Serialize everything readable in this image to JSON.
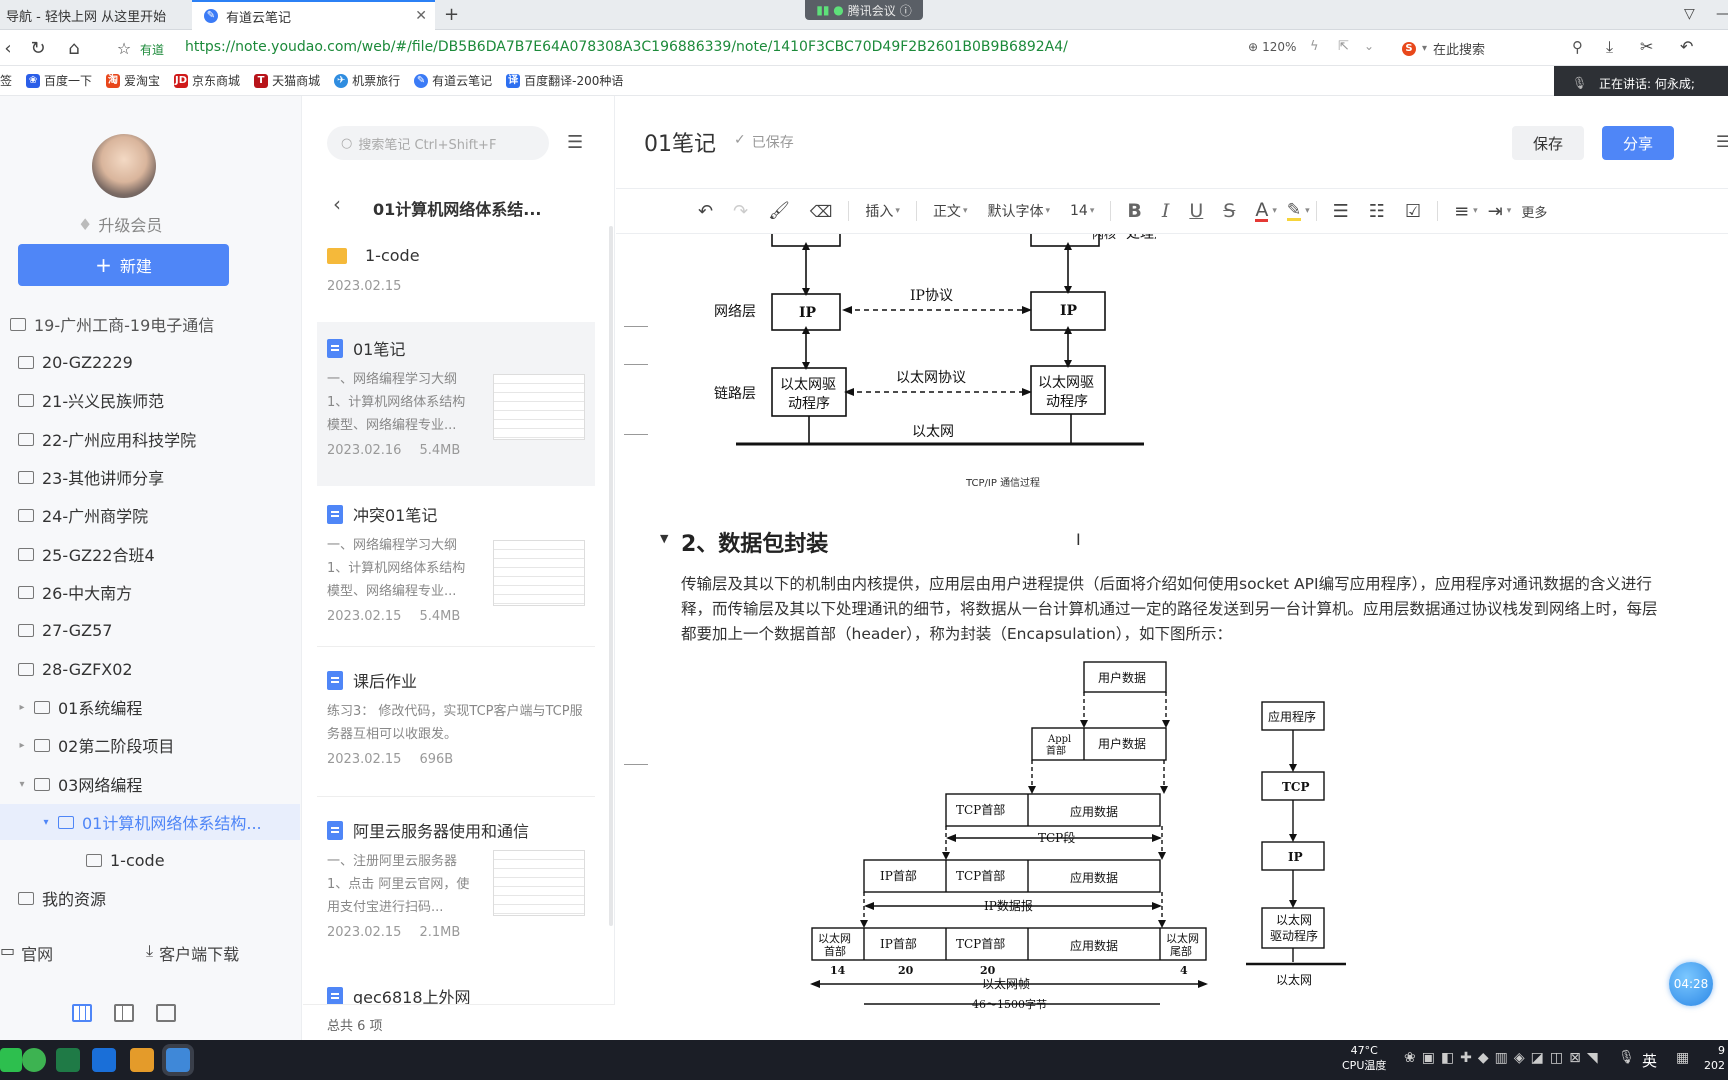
{
  "browser": {
    "tabs": [
      {
        "label": "导航 - 轻快上网 从这里开始"
      },
      {
        "label": "有道云笔记",
        "active": true
      }
    ],
    "meeting_badge": "腾讯会议",
    "url": "https://note.youdao.com/web/#/file/DB5B6DA7B7E64A078308A3C196886339/note/1410F3CBC70D49F2B2601B0B9B6892A4/",
    "site_label": "有道",
    "zoom": "120%",
    "search_placeholder": "在此搜索",
    "bookmarks": [
      "签",
      "百度一下",
      "爱淘宝",
      "京东商城",
      "天猫商城",
      "机票旅行",
      "有道云笔记",
      "百度翻译-200种语"
    ],
    "speaking": "正在讲话: 何永成;"
  },
  "sidebar": {
    "upgrade": "升级会员",
    "new_button": "新建",
    "tree": [
      {
        "label": "19-广州工商-19电子通信",
        "level": 0
      },
      {
        "label": "20-GZ2229",
        "level": 0
      },
      {
        "label": "21-兴义民族师范",
        "level": 0
      },
      {
        "label": "22-广州应用科技学院",
        "level": 0
      },
      {
        "label": "23-其他讲师分享",
        "level": 0
      },
      {
        "label": "24-广州商学院",
        "level": 0
      },
      {
        "label": "25-GZ22合班4",
        "level": 0
      },
      {
        "label": "26-中大南方",
        "level": 0
      },
      {
        "label": "27-GZ57",
        "level": 0
      },
      {
        "label": "28-GZFX02",
        "level": 0
      },
      {
        "label": "01系统编程",
        "level": 1
      },
      {
        "label": "02第二阶段项目",
        "level": 1
      },
      {
        "label": "03网络编程",
        "level": 1
      },
      {
        "label": "01计算机网络体系结构...",
        "level": 2
      },
      {
        "label": "1-code",
        "level": 3
      },
      {
        "label": "我的资源",
        "level": 0
      }
    ],
    "footer_official": "官网",
    "footer_download": "客户端下载"
  },
  "notelist": {
    "search_placeholder": "搜索笔记 Ctrl+Shift+F",
    "folder_title": "01计算机网络体系结...",
    "items": [
      {
        "title": "1-code",
        "type": "folder",
        "date": "2023.02.15",
        "size": ""
      },
      {
        "title": "01笔记",
        "type": "doc",
        "summary": "一、网络编程学习大纲 1、计算机网络体系结构模型、网络编程专业...",
        "date": "2023.02.16",
        "size": "5.4MB"
      },
      {
        "title": "冲突01笔记",
        "type": "doc",
        "summary": "一、网络编程学习大纲 1、计算机网络体系结构模型、网络编程专业...",
        "date": "2023.02.15",
        "size": "5.4MB"
      },
      {
        "title": "课后作业",
        "type": "doc",
        "summary": "练习3： 修改代码，实现TCP客户端与TCP服务器互相可以收跟发。",
        "date": "2023.02.15",
        "size": "696B"
      },
      {
        "title": "阿里云服务器使用和通信",
        "type": "doc",
        "summary": "一、注册阿里云服务器 1、点击 阿里云官网，使用支付宝进行扫码...",
        "date": "2023.02.15",
        "size": "2.1MB"
      },
      {
        "title": "gec6818上外网",
        "type": "doc",
        "summary": "",
        "date": "",
        "size": ""
      }
    ],
    "total": "总共 6 项"
  },
  "editor": {
    "title": "01笔记",
    "saved": "已保存",
    "save_btn": "保存",
    "share_btn": "分享",
    "toolbar": {
      "insert": "插入",
      "style": "正文",
      "font": "默认字体",
      "size": "14",
      "more": "更多"
    },
    "heading": "2、数据包封装",
    "paragraph": [
      "传输层及其以下的机制由内核提供，应用层由用户进程提供（后面将介绍如何使用socket API编写应用程序），应用程序对通讯数据的含义进行",
      "释，而传输层及其以下处理通讯的细节，将数据从一台计算机通过一定的路径发送到另一台计算机。应用层数据通过协议栈发到网络上时，每层",
      "都要加上一个数据首部（header），称为封装（Encapsulation），如下图所示："
    ],
    "fig1": {
      "labels": {
        "network": "网络层",
        "link": "链路层",
        "ip": "IP",
        "ip_proto": "IP协议",
        "eth_driver_a": "以太网驱",
        "eth_driver_b": "动程序",
        "eth_proto": "以太网协议",
        "eth": "以太网",
        "kernel": "内核",
        "detail": "处理通信细节",
        "caption": "TCP/IP 通信过程"
      }
    },
    "fig2": {
      "labels": {
        "user_data": "用户数据",
        "appl_a": "Appl",
        "appl_b": "首部",
        "tcp_head": "TCP首部",
        "app_data": "应用数据",
        "tcp_seg": "TCP段",
        "ip_head": "IP首部",
        "ip_dgram": "IP数据报",
        "eth_head_a": "以太网",
        "eth_head_b": "首部",
        "eth_tail_a": "以太网",
        "eth_tail_b": "尾部",
        "n14": "14",
        "n20a": "20",
        "n20b": "20",
        "n4": "4",
        "eth_frame": "以太网帧",
        "range": "46～1500字节",
        "app": "应用程序",
        "tcp": "TCP",
        "ip": "IP",
        "drv_a": "以太网",
        "drv_b": "驱动程序",
        "eth": "以太网"
      }
    }
  },
  "timer": "04:28",
  "taskbar": {
    "temp": "47°C",
    "temp_label": "CPU温度",
    "ime": "英",
    "clock_a": "9",
    "clock_b": "202"
  }
}
